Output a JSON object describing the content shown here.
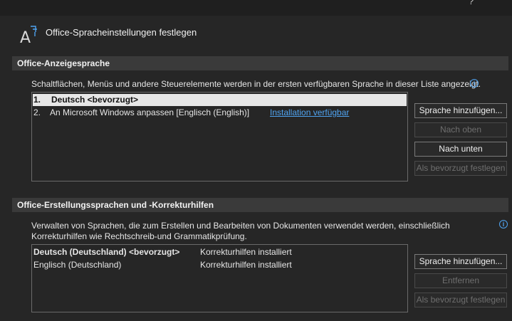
{
  "window": {
    "help_glyph": "?"
  },
  "header": {
    "title": "Office-Spracheinstellungen festlegen",
    "icon": "language-glyph-icon"
  },
  "display_section": {
    "heading": "Office-Anzeigesprache",
    "description": "Schaltflächen, Menüs und andere Steuerelemente werden in der ersten verfügbaren Sprache in dieser Liste angezeigt.",
    "info_glyph": "i",
    "languages": [
      {
        "index": "1.",
        "name": "Deutsch <bevorzugt>",
        "status": ""
      },
      {
        "index": "2.",
        "name": "An Microsoft Windows anpassen [Englisch (English)]",
        "status": "Installation verfügbar"
      }
    ],
    "buttons": {
      "add": "Sprache hinzufügen...",
      "up": "Nach oben",
      "down": "Nach unten",
      "preferred": "Als bevorzugt festlegen"
    }
  },
  "authoring_section": {
    "heading": "Office-Erstellungssprachen und -Korrekturhilfen",
    "description": "Verwalten von Sprachen, die zum Erstellen und Bearbeiten von Dokumenten verwendet werden, einschließlich Korrekturhilfen wie Rechtschreib-und Grammatikprüfung.",
    "info_glyph": "i",
    "languages": [
      {
        "name": "Deutsch (Deutschland) <bevorzugt>",
        "status": "Korrekturhilfen installiert"
      },
      {
        "name": "Englisch (Deutschland)",
        "status": "Korrekturhilfen installiert"
      }
    ],
    "buttons": {
      "add": "Sprache hinzufügen...",
      "remove": "Entfernen",
      "preferred": "Als bevorzugt festlegen"
    }
  },
  "colors": {
    "background": "#262626",
    "section_bar": "#3a3a3a",
    "link": "#4fa3f0",
    "selection": "#e6e6e6"
  }
}
